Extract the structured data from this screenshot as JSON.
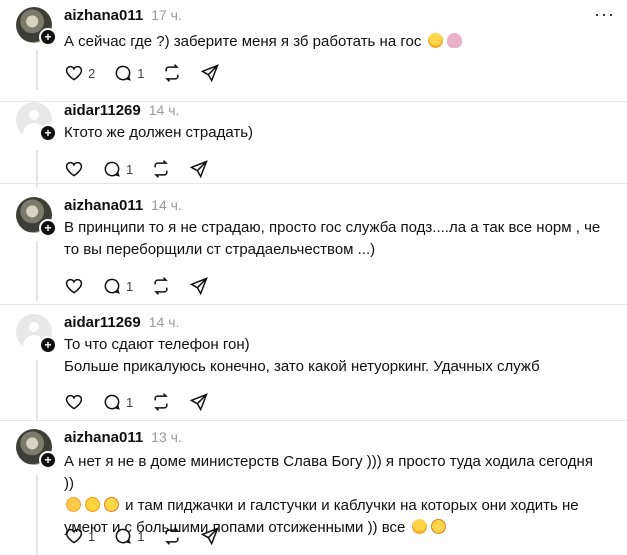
{
  "posts": [
    {
      "username": "aizhana011",
      "time": "17 ч.",
      "avatar": "photo",
      "lines": [
        "А сейчас где ?) заберите меня я зб работать на гос"
      ],
      "emojis_line0": [
        "smiling-face-with-hearts-emoji",
        "woman-tipping-hand-emoji"
      ],
      "likes": "2",
      "replies": "1"
    },
    {
      "username": "aidar11269",
      "time": "14 ч.",
      "avatar": "default",
      "lines": [
        "Ктото же должен страдать)"
      ],
      "likes": "",
      "replies": "1"
    },
    {
      "username": "aizhana011",
      "time": "14 ч.",
      "avatar": "photo",
      "lines": [
        "В принципи то я не страдаю, просто гос служба подз....ла а так все норм , че",
        "то вы переборщили ст страдаельчеством ...)"
      ],
      "likes": "",
      "replies": "1"
    },
    {
      "username": "aidar11269",
      "time": "14 ч.",
      "avatar": "default",
      "lines": [
        "То что сдают телефон гон)",
        "Больше прикалуюсь конечно, зато какой нетуоркинг. Удачных служб"
      ],
      "likes": "",
      "replies": "1"
    },
    {
      "username": "aizhana011",
      "time": "13 ч.",
      "avatar": "photo",
      "lines": [
        "А нет я не в доме министерств Слава Богу ))) я просто туда ходила сегодня ))",
        "и там пиджачки и галстучки и каблучки на которых они ходить не",
        "умеют и с большими попами отсиженными )) все"
      ],
      "likes": "1",
      "replies": "1"
    }
  ],
  "icons": {
    "like": "heart-icon",
    "reply": "comment-icon",
    "repost": "repost-icon",
    "share": "send-icon",
    "more": "more-options-icon",
    "follow": "plus-icon"
  },
  "more_glyph": "···",
  "plus_glyph": "+"
}
